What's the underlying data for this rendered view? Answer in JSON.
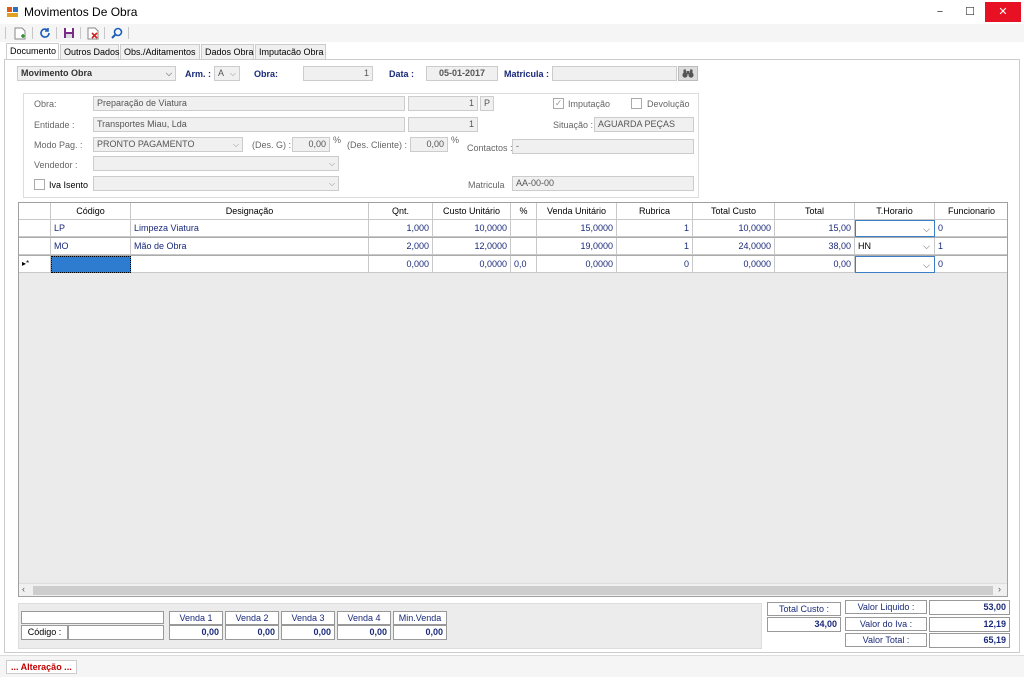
{
  "window": {
    "title": "Movimentos De Obra",
    "minimize": "−",
    "maximize": "☐",
    "close": "✕"
  },
  "tabs": [
    "Documento",
    "Outros Dados",
    "Obs./Aditamentos",
    "Dados Obra",
    "Imputacão Obra"
  ],
  "header": {
    "movimento": "Movimento Obra",
    "arm_label": "Arm. :",
    "arm_value": "A",
    "obra_label": "Obra:",
    "obra_value": "1",
    "data_label": "Data :",
    "data_value": "05-01-2017",
    "matricula_label": "Matricula :",
    "matricula_value": ""
  },
  "details": {
    "obra_label": "Obra:",
    "obra_value": "Preparação de Viatura",
    "obra_num": "1",
    "obra_p": "P",
    "entidade_label": "Entidade :",
    "entidade_value": "Transportes Miau, Lda",
    "entidade_num": "1",
    "modo_label": "Modo Pag. :",
    "modo_value": "PRONTO PAGAMENTO",
    "desg_label": "(Des. G) :",
    "desg_value": "0,00",
    "pct1": "%",
    "descli_label": "(Des. Cliente) :",
    "descli_value": "0,00",
    "pct2": "%",
    "vendedor_label": "Vendedor :",
    "vendedor_value": "",
    "iva_label": "Iva Isento",
    "iva_value": "",
    "imputacao_label": "Imputação",
    "imputacao_check": "✓",
    "devolucao_label": "Devolução",
    "situacao_label": "Situação :",
    "situacao_value": "AGUARDA PEÇAS",
    "contactos_label": "Contactos :",
    "contactos_value": "-",
    "matricula_label": "Matricula",
    "matricula_value": "AA-00-00"
  },
  "grid": {
    "columns": [
      "Código",
      "Designação",
      "Qnt.",
      "Custo Unitário",
      "%",
      "Venda Unitário",
      "Rubrica",
      "Total Custo",
      "Total",
      "T.Horario",
      "Funcionario"
    ],
    "rows": [
      {
        "codigo": "LP",
        "designacao": "Limpeza Viatura",
        "qnt": "1,000",
        "custo": "10,0000",
        "pct": "",
        "venda": "15,0000",
        "rubrica": "1",
        "total_custo": "10,0000",
        "total": "15,00",
        "thorario": "",
        "funcionario": "0"
      },
      {
        "codigo": "MO",
        "designacao": "Mão de Obra",
        "qnt": "2,000",
        "custo": "12,0000",
        "pct": "",
        "venda": "19,0000",
        "rubrica": "1",
        "total_custo": "24,0000",
        "total": "38,00",
        "thorario": "HN",
        "funcionario": "1"
      },
      {
        "codigo": "",
        "designacao": "",
        "qnt": "0,000",
        "custo": "0,0000",
        "pct": "0,0",
        "venda": "0,0000",
        "rubrica": "0",
        "total_custo": "0,0000",
        "total": "0,00",
        "thorario": "",
        "funcionario": "0"
      }
    ],
    "new_row_marker": "▸*"
  },
  "bottom": {
    "codigo_label": "Código :",
    "venda_labels": [
      "Venda 1",
      "Venda 2",
      "Venda 3",
      "Venda 4",
      "Min.Venda"
    ],
    "venda_values": [
      "0,00",
      "0,00",
      "0,00",
      "0,00",
      "0,00"
    ],
    "total_custo_label": "Total Custo :",
    "total_custo_value": "34,00",
    "valor_liquido_label": "Valor Liquido :",
    "valor_liquido_value": "53,00",
    "valor_iva_label": "Valor do Iva :",
    "valor_iva_value": "12,19",
    "valor_total_label": "Valor Total :",
    "valor_total_value": "65,19"
  },
  "status": {
    "text": "... Alteração ..."
  },
  "colors": {
    "accent": "#1a2a7a",
    "status": "#c00000",
    "close": "#e81123",
    "selection": "#2d7ccf"
  }
}
